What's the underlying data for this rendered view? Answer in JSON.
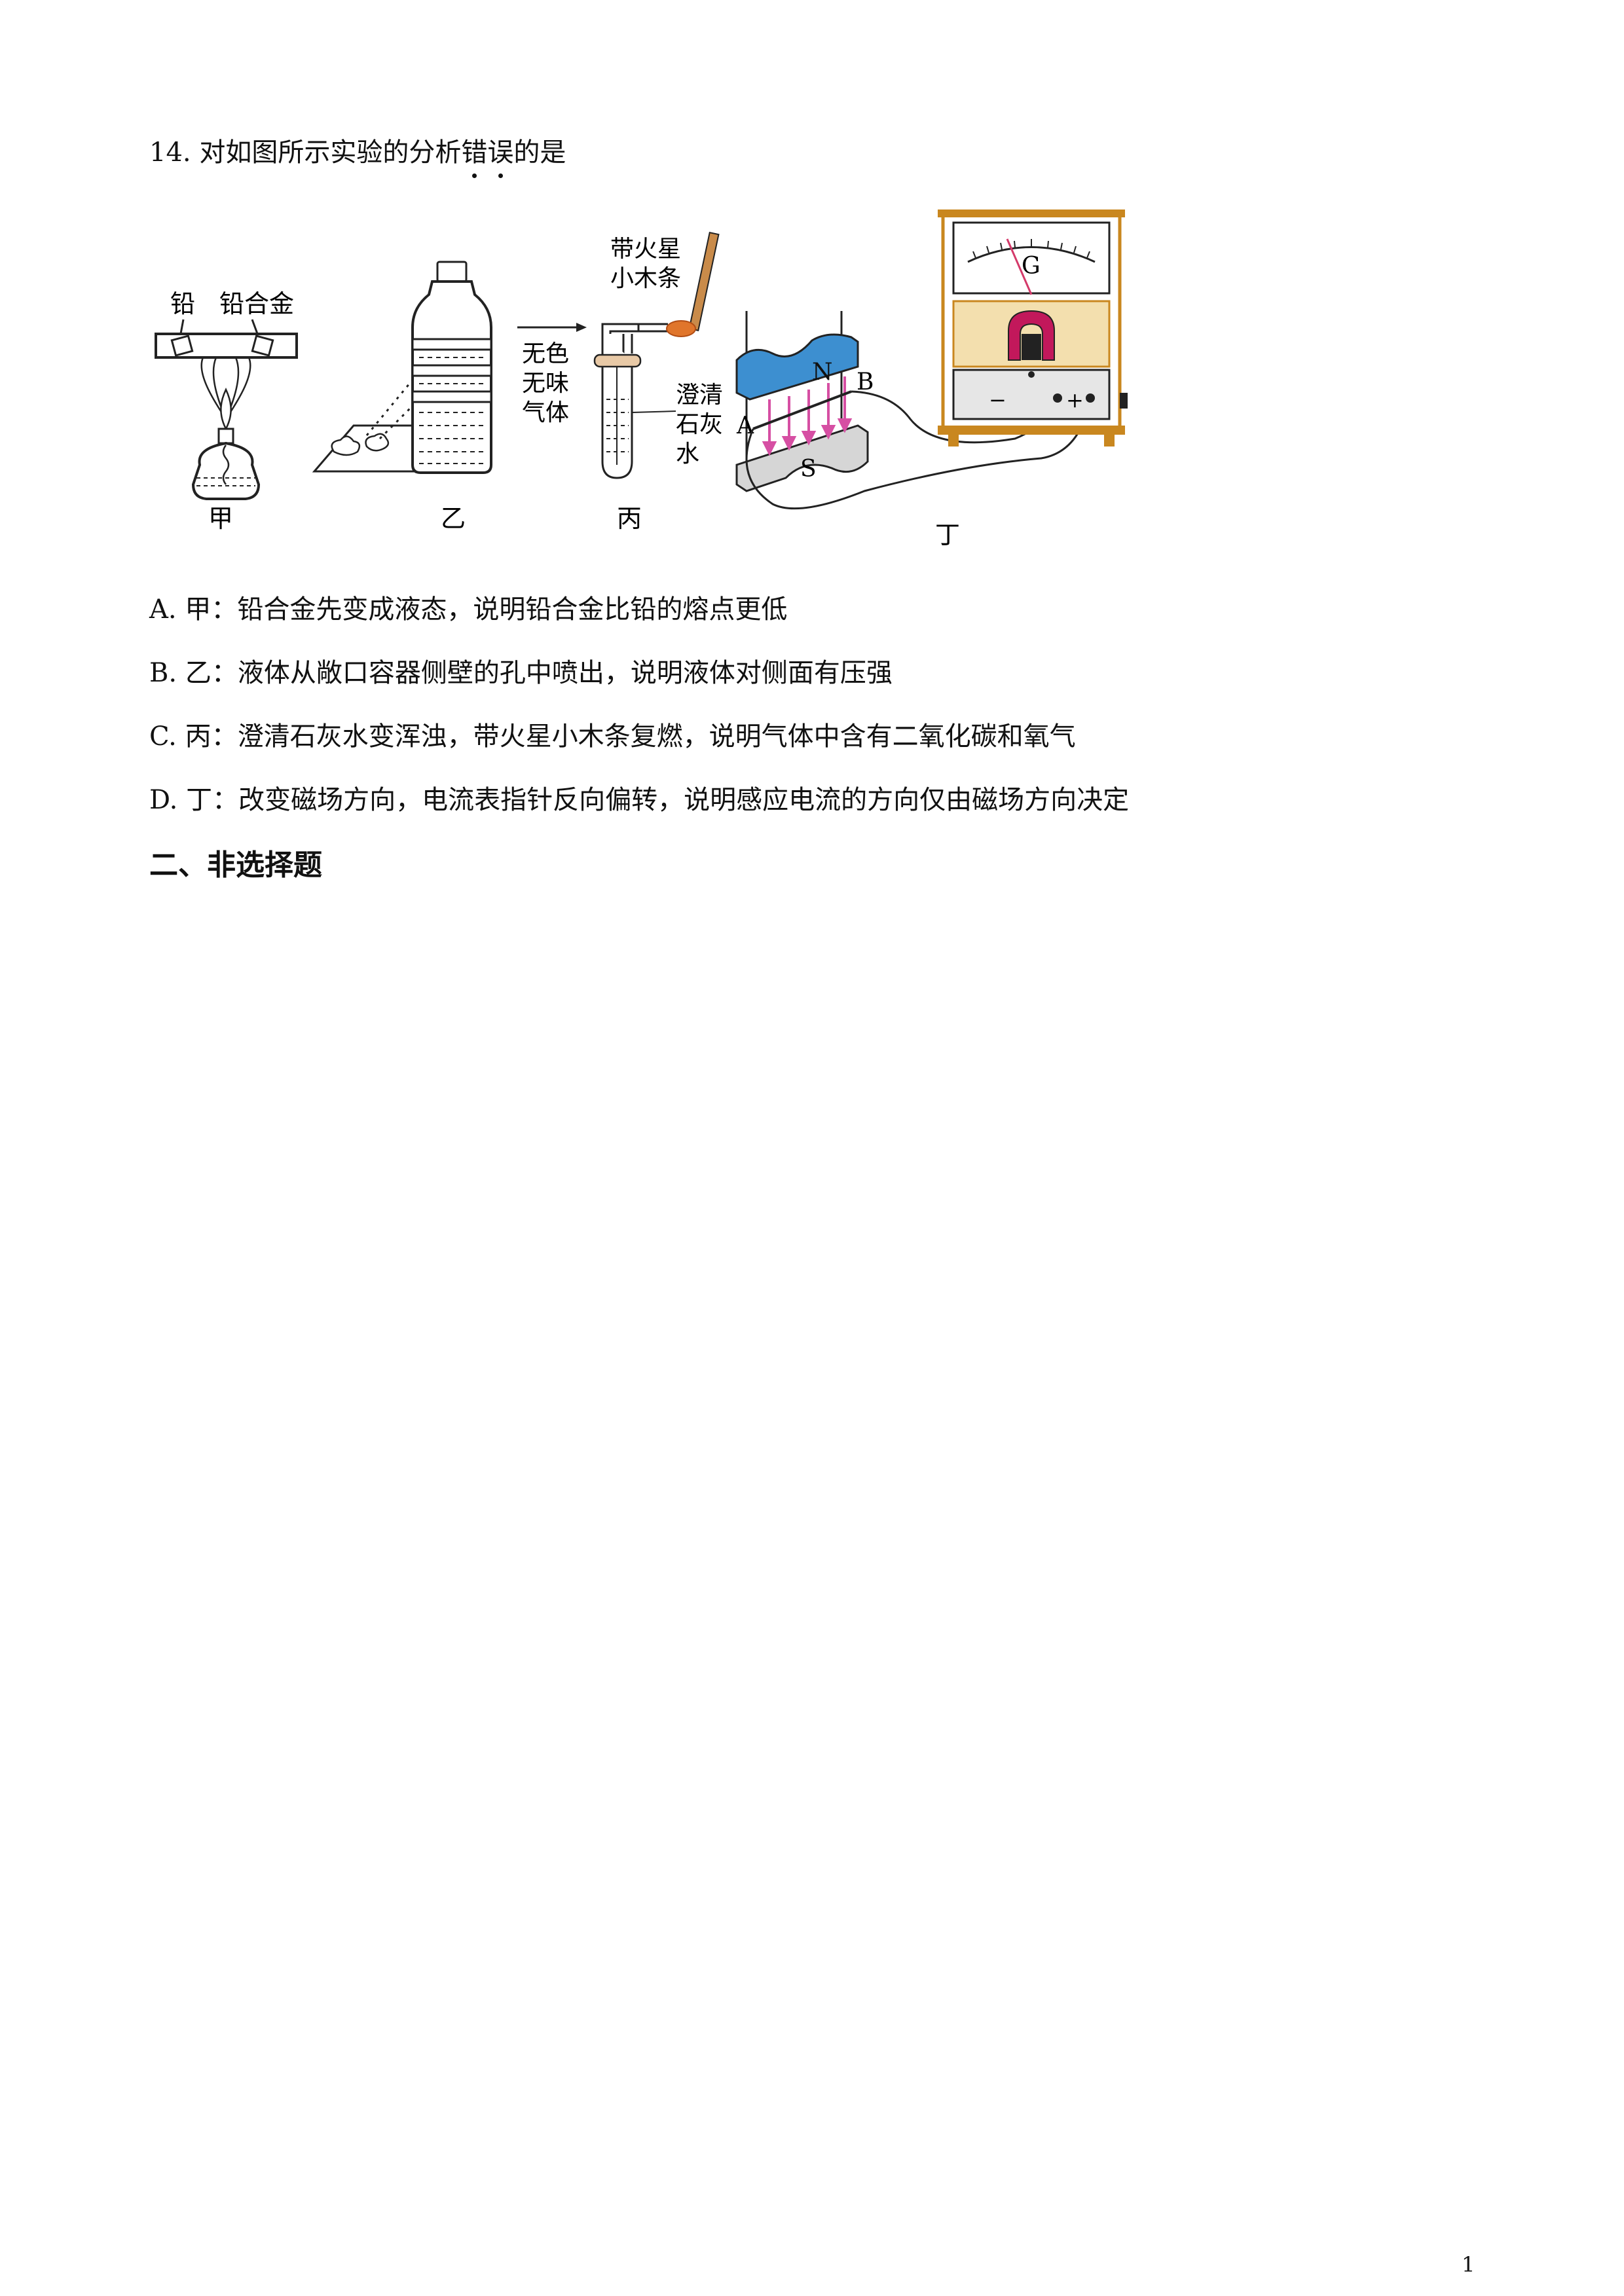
{
  "question": {
    "number": "14.",
    "text_before": "对如图所示实验的分析",
    "emphasis": "错误",
    "text_after": "的是"
  },
  "figure": {
    "jia": {
      "caption": "甲",
      "label_lead": "铅",
      "label_alloy": "铅合金"
    },
    "yi": {
      "caption": "乙"
    },
    "bing": {
      "caption": "丙",
      "gas_label": [
        "无色",
        "无味",
        "气体"
      ],
      "splint_label": [
        "带火星",
        "小木条"
      ],
      "limewater_label": [
        "澄清",
        "石灰",
        "水"
      ]
    },
    "ding": {
      "caption": "丁",
      "pole_n": "N",
      "pole_s": "S",
      "point_a": "A",
      "point_b": "B",
      "meter_label": "G",
      "terminal_minus": "−",
      "terminal_plus": "+"
    }
  },
  "options": [
    {
      "letter": "A.",
      "text": "甲：铅合金先变成液态，说明铅合金比铅的熔点更低"
    },
    {
      "letter": "B.",
      "text": "乙：液体从敞口容器侧壁的孔中喷出，说明液体对侧面有压强"
    },
    {
      "letter": "C.",
      "text": "丙：澄清石灰水变浑浊，带火星小木条复燃，说明气体中含有二氧化碳和氧气"
    },
    {
      "letter": "D.",
      "text": "丁：改变磁场方向，电流表指针反向偏转，说明感应电流的方向仅由磁场方向决定"
    }
  ],
  "section_heading": "二、非选择题",
  "page_number": "1",
  "colors": {
    "magnet_blue": "#3d8fd0",
    "field_arrow": "#d64fa3",
    "meter_wood": "#c9871f",
    "flame": "#e0752b"
  }
}
